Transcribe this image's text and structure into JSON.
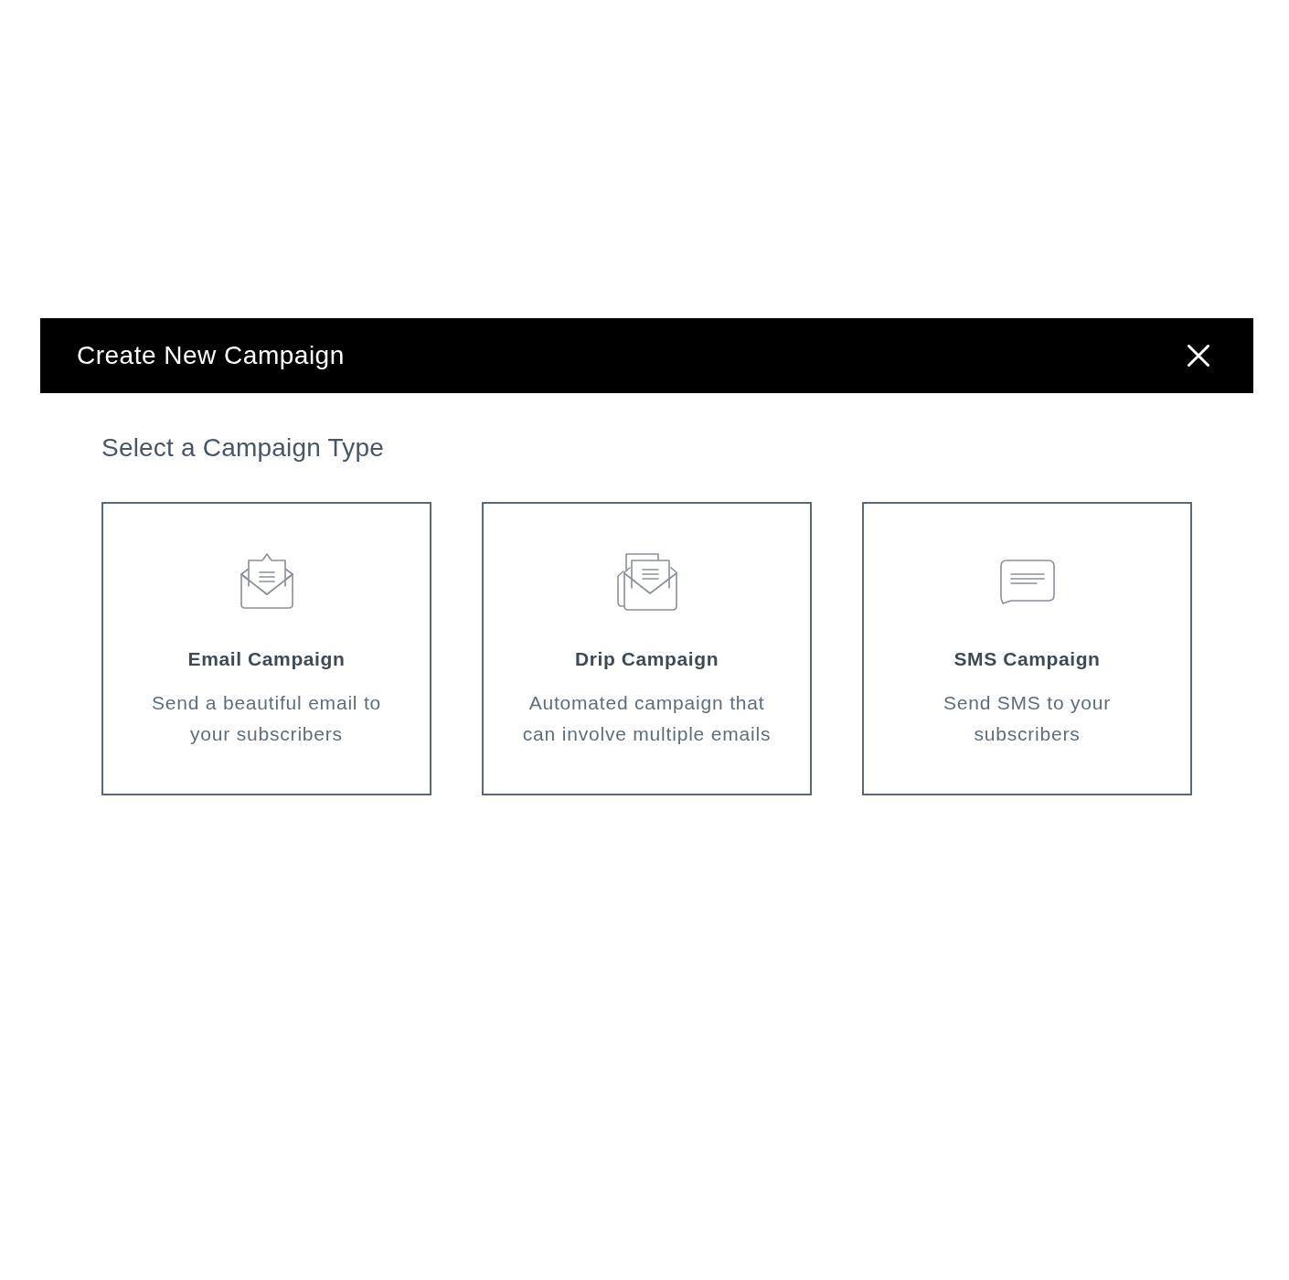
{
  "dialog": {
    "title": "Create New Campaign"
  },
  "section_title": "Select a Campaign Type",
  "campaign_types": [
    {
      "kind": "email",
      "title": "Email Campaign",
      "description": "Send a beautiful email to your subscribers"
    },
    {
      "kind": "drip",
      "title": "Drip Campaign",
      "description": "Automated campaign that can involve multiple emails"
    },
    {
      "kind": "sms",
      "title": "SMS Campaign",
      "description": "Send SMS to your subscribers"
    }
  ]
}
